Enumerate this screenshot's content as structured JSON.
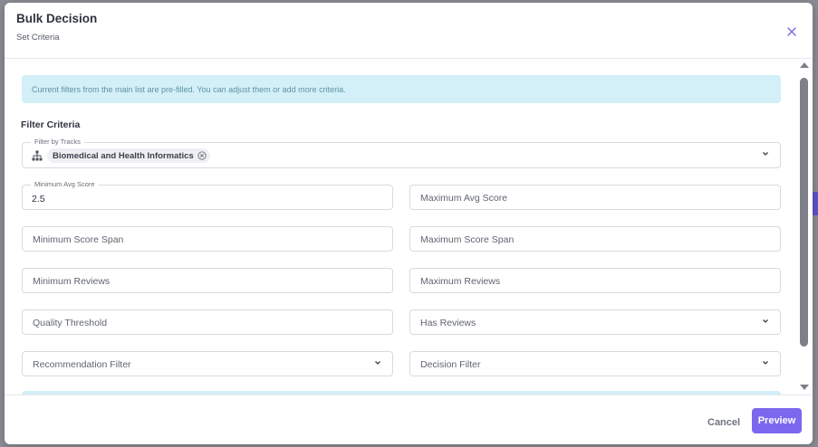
{
  "dialog": {
    "title": "Bulk Decision",
    "subtitle": "Set Criteria",
    "close_icon": "close-icon"
  },
  "alert": {
    "text": "Current filters from the main list are pre-filled. You can adjust them or add more criteria."
  },
  "filter_criteria": {
    "heading": "Filter Criteria",
    "tracks": {
      "legend": "Filter by Tracks",
      "icon": "hierarchy-icon",
      "selected_chip": "Biomedical and Health Informatics"
    },
    "min_avg_score": {
      "legend": "Minimum Avg Score",
      "value": "2.5"
    },
    "max_avg_score": {
      "placeholder": "Maximum Avg Score"
    },
    "min_score_span": {
      "placeholder": "Minimum Score Span"
    },
    "max_score_span": {
      "placeholder": "Maximum Score Span"
    },
    "min_reviews": {
      "placeholder": "Minimum Reviews"
    },
    "max_reviews": {
      "placeholder": "Maximum Reviews"
    },
    "quality_threshold": {
      "placeholder": "Quality Threshold"
    },
    "has_reviews": {
      "placeholder": "Has Reviews"
    },
    "recommendation_filter": {
      "placeholder": "Recommendation Filter"
    },
    "decision_filter": {
      "placeholder": "Decision Filter"
    }
  },
  "footer": {
    "cancel_label": "Cancel",
    "preview_label": "Preview"
  },
  "colors": {
    "accent": "#7b68ee",
    "alert_bg": "#d3eff7",
    "alert_text": "#5e93a5"
  }
}
